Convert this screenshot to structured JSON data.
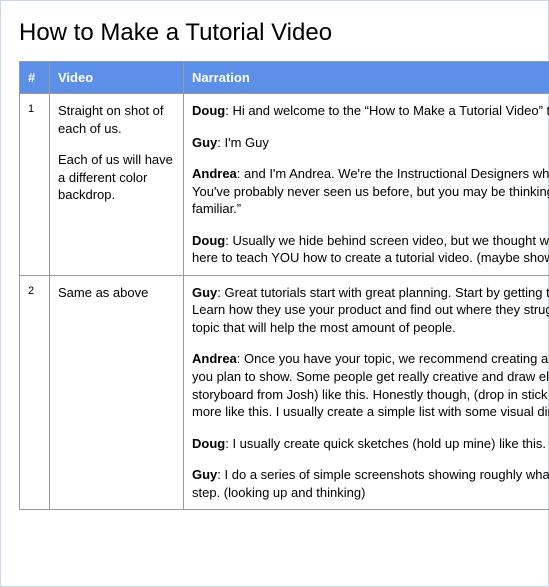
{
  "title": "How to Make a Tutorial Video",
  "columns": {
    "num": "#",
    "video": "Video",
    "narration": "Narration"
  },
  "rows": [
    {
      "num": "1",
      "video": [
        "Straight on shot of each of us.",
        "Each of us will have a different color backdrop."
      ],
      "narration": [
        {
          "speaker": "Doug",
          "text": ": Hi and welcome to the “How to Make a Tutorial Video” tutorial."
        },
        {
          "speaker": "Guy",
          "text": ": I'm Guy"
        },
        {
          "speaker": "Andrea",
          "text": ": and I'm Andrea.  We're the Instructional Designers who make tutorial videos. You've probably never seen us before, but you may be thinking, “that voice sounds familiar.”"
        },
        {
          "speaker": "Doug",
          "text": ": Usually we hide behind screen video, but we thought we'd come out from hiding here to teach YOU how to create a tutorial video. (maybe show screen video behind)"
        }
      ]
    },
    {
      "num": "2",
      "video": [
        "Same as above"
      ],
      "narration": [
        {
          "speaker": "Guy",
          "text": ": Great tutorials start with great planning. Start by getting to know your audience. Learn how they use your product and find out where they struggle. Then choose a tutorial topic that will help the most amount of people."
        },
        {
          "speaker": "Andrea",
          "text": ": Once you have your topic, we recommend creating a storyboard to outline what you plan to show.  Some people get really creative and draw elaborate pictures (drop in storyboard from Josh) like this. Honestly though, (drop in stick figure image) mine look more like this. I usually create a simple list with some visual direction thrown in."
        },
        {
          "speaker": "Doug",
          "text": ": I usually create quick sketches (hold up mine) like this."
        },
        {
          "speaker": "Guy",
          "text": ": I do a series of simple screenshots showing roughly what I plan to show at each step. (looking up and thinking)"
        }
      ]
    }
  ]
}
